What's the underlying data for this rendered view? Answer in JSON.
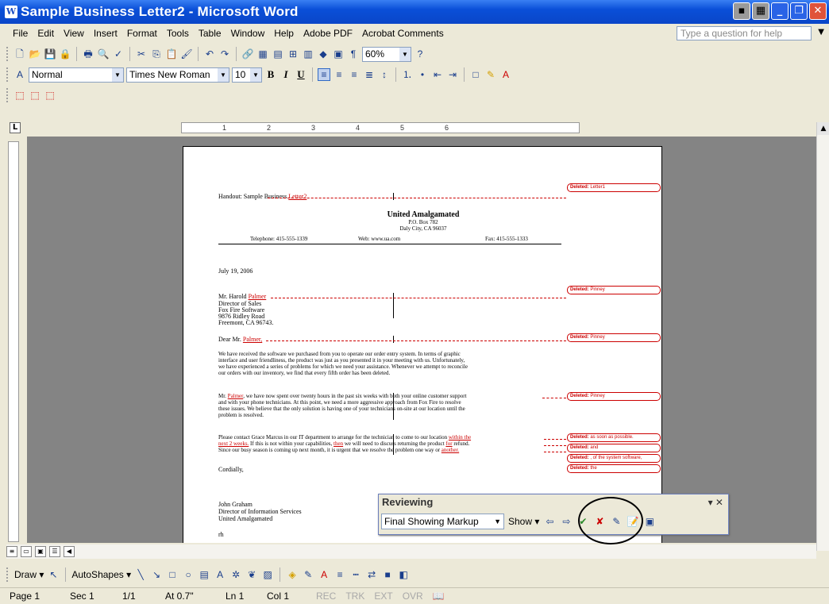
{
  "window": {
    "title": "Sample Business Letter2 - Microsoft Word"
  },
  "menu": [
    "File",
    "Edit",
    "View",
    "Insert",
    "Format",
    "Tools",
    "Table",
    "Window",
    "Help",
    "Adobe PDF",
    "Acrobat Comments"
  ],
  "help_placeholder": "Type a question for help",
  "standard_toolbar": {
    "zoom": "60%"
  },
  "formatting_toolbar": {
    "style": "Normal",
    "font": "Times New Roman",
    "size": "10",
    "bold": "B",
    "italic": "I",
    "underline": "U"
  },
  "ruler": {
    "marks": [
      "1",
      "2",
      "3",
      "4",
      "5",
      "6"
    ],
    "corner": "L"
  },
  "document": {
    "header_line": "Handout: Sample Business",
    "header_deleted": "Letter2",
    "company": "United Amalgamated",
    "po_box": "P.O. Box 782",
    "city": "Daly City, CA 96037",
    "telephone": "Telephone: 415-555-1339",
    "web": "Web: www.ua.com",
    "fax": "Fax: 415-555-1333",
    "date": "July 19, 2006",
    "recipient_prefix": "Mr. Harold",
    "recipient_deleted": "Palmer",
    "address": [
      "Director of Sales",
      "Fox Fire Software",
      "9876 Ridley Road",
      "Freemont, CA 96743."
    ],
    "salutation_prefix": "Dear Mr.",
    "salutation_deleted": "Palmer,",
    "para1": [
      "We have received the software we purchased from you to operate our order entry system.  In terms of graphic",
      "interface and user friendliness, the product was just as you presented it in your meeting with us.  Unfortunately,",
      "we have experienced a series of problems for which we need your assistance.  Whenever we attempt to reconcile",
      "our orders with our inventory, we find that every fifth order has been deleted."
    ],
    "para2_prefix": "Mr.",
    "para2_deleted": "Palmer",
    "para2_first_rest": ", we have now spent over twenty hours in the past six weeks with both your online customer support",
    "para2": [
      "and with your phone technicians.  At this point, we need a more aggressive approach from Fox Fire to resolve",
      "these issues.  We believe that the only solution is having one of your technicians on-site at our location until the",
      "problem is resolved."
    ],
    "para3_line1": "Please contact Grace Marcus in our IT department to arrange for the technician to come to our location",
    "para3_del1": "within the",
    "para3_del1b": "next 2 weeks.",
    "para3_line2": "  If this is not within your capabilities,",
    "para3_del2": "then",
    "para3_line2b": "we will need to discuss returning the product",
    "para3_del3": "for",
    "para3_line2c": "refund.",
    "para3_line3": "Since our busy season is coming up next month, it is urgent that we resolve the problem one way or",
    "para3_del4": "another.",
    "closing": "Cordially,",
    "signature": [
      "John Graham",
      "Director of Information Services",
      "United Amalgamated"
    ],
    "initials": "rh"
  },
  "balloons": [
    {
      "label": "Deleted:",
      "text": "Letter1"
    },
    {
      "label": "Deleted:",
      "text": "Pinney"
    },
    {
      "label": "Deleted:",
      "text": "Pinney"
    },
    {
      "label": "Deleted:",
      "text": "Pinney"
    },
    {
      "label": "Deleted:",
      "text": "as soon as possible."
    },
    {
      "label": "Deleted:",
      "text": "and"
    },
    {
      "label": "Deleted:",
      "text": ", of the system software,"
    },
    {
      "label": "Deleted:",
      "text": "the"
    }
  ],
  "reviewing_toolbar": {
    "title": "Reviewing",
    "display": "Final Showing Markup",
    "show": "Show"
  },
  "draw_toolbar": {
    "draw": "Draw",
    "autoshapes": "AutoShapes"
  },
  "status": {
    "page": "Page 1",
    "sec": "Sec 1",
    "pages": "1/1",
    "at": "At 0.7\"",
    "ln": "Ln 1",
    "col": "Col 1",
    "rec": "REC",
    "trk": "TRK",
    "ext": "EXT",
    "ovr": "OVR"
  }
}
